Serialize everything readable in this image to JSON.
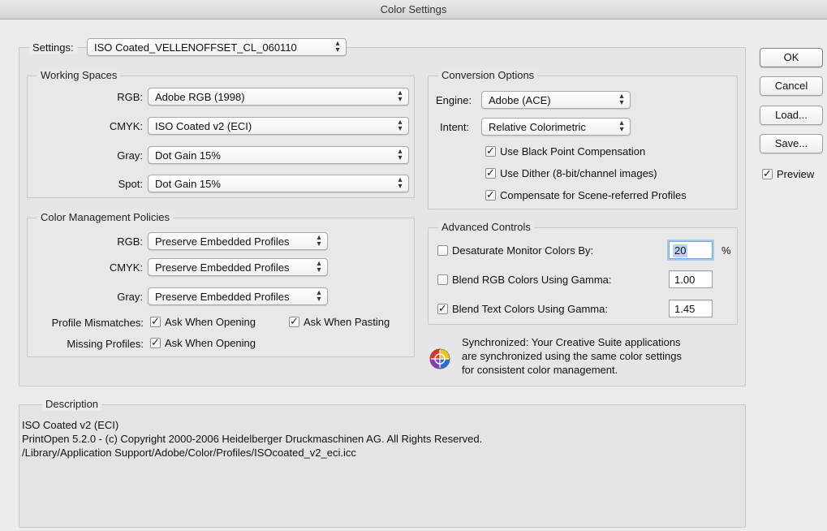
{
  "window": {
    "title": "Color Settings"
  },
  "settings": {
    "label": "Settings:",
    "value": "ISO Coated_VELLENOFFSET_CL_060110"
  },
  "working_spaces": {
    "title": "Working Spaces",
    "rgb_label": "RGB:",
    "rgb_value": "Adobe RGB (1998)",
    "cmyk_label": "CMYK:",
    "cmyk_value": "ISO Coated v2 (ECI)",
    "gray_label": "Gray:",
    "gray_value": "Dot Gain 15%",
    "spot_label": "Spot:",
    "spot_value": "Dot Gain 15%"
  },
  "conversion_options": {
    "title": "Conversion Options",
    "engine_label": "Engine:",
    "engine_value": "Adobe (ACE)",
    "intent_label": "Intent:",
    "intent_value": "Relative Colorimetric",
    "black_point_label": "Use Black Point Compensation",
    "black_point_checked": true,
    "dither_label": "Use Dither (8-bit/channel images)",
    "dither_checked": true,
    "scene_label": "Compensate for Scene-referred Profiles",
    "scene_checked": true
  },
  "policies": {
    "title": "Color Management Policies",
    "rgb_label": "RGB:",
    "rgb_value": "Preserve Embedded Profiles",
    "cmyk_label": "CMYK:",
    "cmyk_value": "Preserve Embedded Profiles",
    "gray_label": "Gray:",
    "gray_value": "Preserve Embedded Profiles",
    "mismatch_label": "Profile Mismatches:",
    "ask_opening_label": "Ask When Opening",
    "ask_pasting_label": "Ask When Pasting",
    "missing_label": "Missing Profiles:",
    "missing_ask_opening_label": "Ask When Opening"
  },
  "advanced": {
    "title": "Advanced Controls",
    "desaturate_label": "Desaturate Monitor Colors By:",
    "desaturate_value": "20",
    "desaturate_unit": "%",
    "desaturate_checked": false,
    "blend_rgb_label": "Blend RGB Colors Using Gamma:",
    "blend_rgb_value": "1.00",
    "blend_rgb_checked": false,
    "blend_text_label": "Blend Text Colors Using Gamma:",
    "blend_text_value": "1.45",
    "blend_text_checked": true
  },
  "sync": {
    "line1": "Synchronized: Your Creative Suite applications",
    "line2": "are synchronized using the same color settings",
    "line3": "for consistent color management."
  },
  "description": {
    "title": "Description",
    "line1": "ISO Coated v2 (ECI)",
    "line2": "PrintOpen 5.2.0 - (c) Copyright 2000-2006 Heidelberger Druckmaschinen AG. All Rights Reserved.",
    "line3": "/Library/Application Support/Adobe/Color/Profiles/ISOcoated_v2_eci.icc"
  },
  "buttons": {
    "ok": "OK",
    "cancel": "Cancel",
    "load": "Load...",
    "save": "Save...",
    "preview": "Preview",
    "preview_checked": true
  },
  "tick_glyph": "✓",
  "arrows_glyph": "⇕"
}
